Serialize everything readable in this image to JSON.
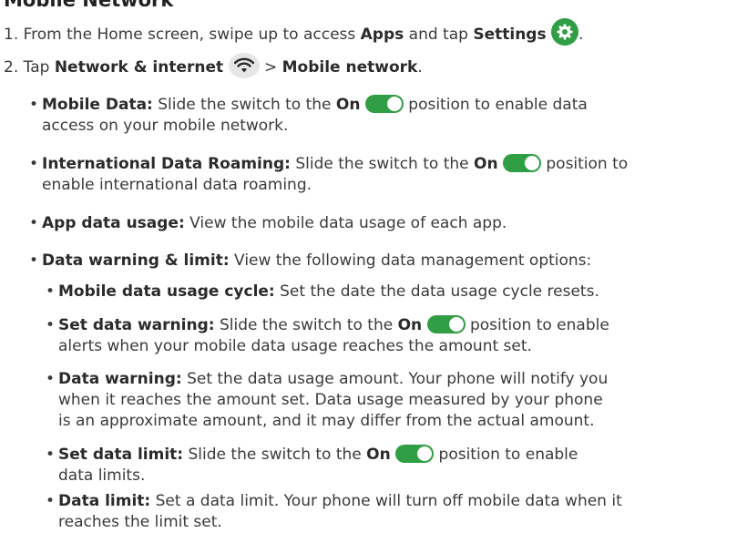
{
  "heading": "Mobile Network",
  "step1": {
    "text": "1. From the Home screen, swipe up to access ",
    "apps": "Apps",
    "and_tap": " and tap ",
    "settings": "Settings",
    "end": "."
  },
  "step2": {
    "text": "2. Tap ",
    "network": "Network & internet",
    "arrow": " > ",
    "mobile_network": "Mobile network",
    "end": "."
  },
  "bullets": {
    "mobile_data": {
      "label": "Mobile Data:",
      "pre": " Slide the switch to the ",
      "on": "On",
      "post": " position to enable data",
      "line2": "access on your mobile network."
    },
    "roaming": {
      "label": "International Data Roaming:",
      "pre": " Slide the switch to the ",
      "on": "On",
      "post": " position to",
      "line2": "enable international data roaming."
    },
    "app_usage": {
      "label": "App data usage:",
      "text": " View the mobile data usage of each app."
    },
    "warning_limit": {
      "label": "Data warning & limit:",
      "text": " View the following data management options:"
    },
    "usage_cycle": {
      "label": "Mobile data usage cycle:",
      "text": " Set the date the data usage cycle resets."
    },
    "set_warning": {
      "label": "Set data warning:",
      "pre": " Slide the switch to the ",
      "on": "On",
      "post": " position to enable",
      "line2": "alerts when your mobile data usage reaches the amount set."
    },
    "data_warning": {
      "label": "Data warning:",
      "text": " Set the data usage amount. Your phone will notify you",
      "line2": "when it reaches the amount set. Data usage measured by your phone",
      "line3": "is an approximate amount, and it may differ from the actual amount."
    },
    "set_limit": {
      "label": "Set data limit:",
      "pre": " Slide the switch to the ",
      "on": "On",
      "post": " position to enable",
      "line2": "data limits."
    },
    "data_limit": {
      "label": "Data limit:",
      "text": " Set a data limit. Your phone will turn off mobile data when it",
      "line2": "reaches the limit set."
    }
  },
  "icons": {
    "settings": "gear-icon",
    "network": "wifi-icon",
    "toggle": "toggle-on-icon"
  },
  "colors": {
    "accent_green": "#2f9e44",
    "text": "#3a3a3a"
  }
}
